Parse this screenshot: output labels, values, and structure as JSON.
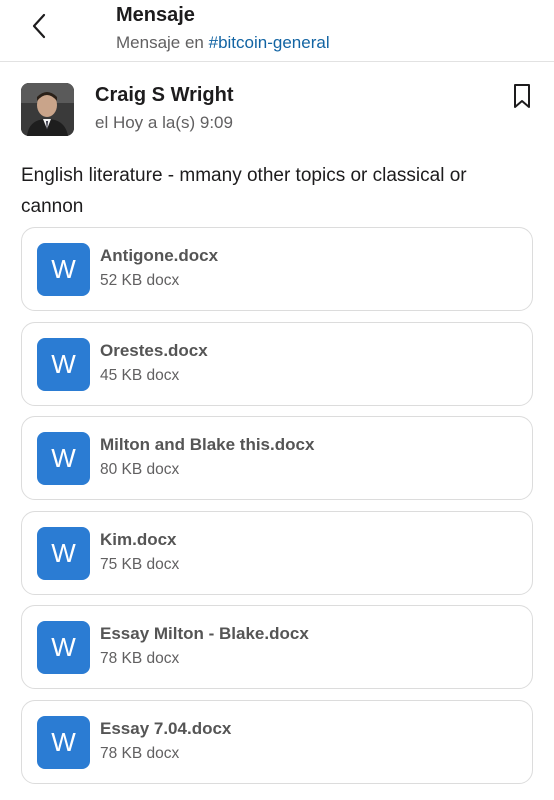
{
  "header": {
    "title": "Mensaje",
    "subtitle_prefix": "Mensaje en",
    "channel": "#bitcoin-general"
  },
  "message": {
    "author": "Craig S Wright",
    "timestamp": "el Hoy a la(s) 9:09",
    "text": "English literature - mmany other topics or classical or cannon"
  },
  "files": [
    {
      "name": "Antigone.docx",
      "meta": "52 KB docx",
      "icon_letter": "W"
    },
    {
      "name": "Orestes.docx",
      "meta": "45 KB docx",
      "icon_letter": "W"
    },
    {
      "name": "Milton and Blake this.docx",
      "meta": "80 KB docx",
      "icon_letter": "W"
    },
    {
      "name": "Kim.docx",
      "meta": "75 KB docx",
      "icon_letter": "W"
    },
    {
      "name": "Essay Milton - Blake.docx",
      "meta": "78 KB docx",
      "icon_letter": "W"
    },
    {
      "name": "Essay 7.04.docx",
      "meta": "78 KB docx",
      "icon_letter": "W"
    }
  ],
  "icons": {
    "back": "chevron-left-icon",
    "bookmark": "bookmark-icon",
    "file": "word-doc-icon"
  },
  "colors": {
    "link": "#1264a3",
    "word_blue": "#2b7cd3",
    "text": "#1d1c1d",
    "muted": "#616061"
  }
}
